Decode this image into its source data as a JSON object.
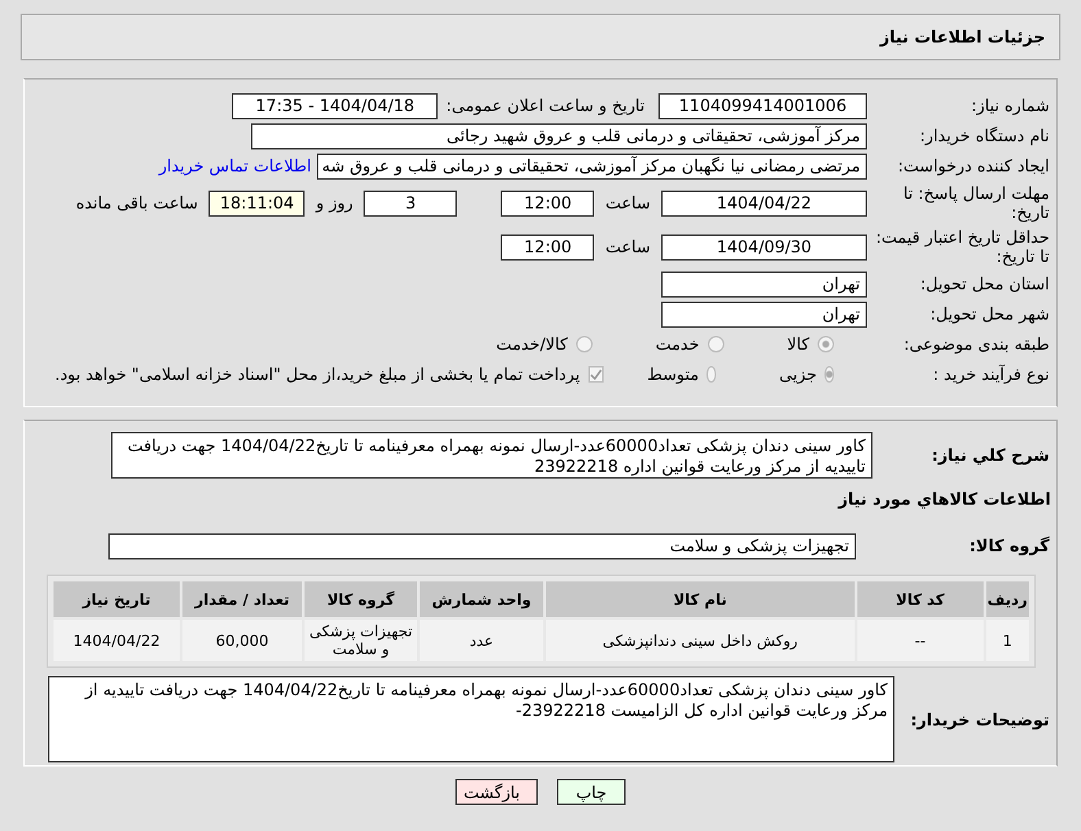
{
  "header": {
    "title": "جزئیات اطلاعات نیاز"
  },
  "need_number": {
    "label": "شماره نیاز:",
    "value": "1104099414001006"
  },
  "announce": {
    "label": "تاریخ و ساعت اعلان عمومی:",
    "value": "1404/04/18 - 17:35"
  },
  "buyer_org": {
    "label": "نام دستگاه خریدار:",
    "value": "مرکز آموزشی، تحقیقاتی و درمانی قلب و عروق شهید رجائی"
  },
  "creator": {
    "label": "ایجاد کننده درخواست:",
    "value": "مرتضی رمضانی نیا نگهبان مرکز آموزشی، تحقیقاتی و درمانی قلب و عروق شه",
    "link": "اطلاعات تماس خریدار"
  },
  "reply_deadline": {
    "label": "مهلت ارسال پاسخ: تا تاریخ:",
    "date": "1404/04/22",
    "time_label": "ساعت",
    "time": "12:00",
    "days": "3",
    "days_label": "روز و",
    "remaining": "18:11:04",
    "remaining_label": "ساعت باقی مانده"
  },
  "price_validity": {
    "label": "حداقل تاریخ اعتبار قیمت: تا تاریخ:",
    "date": "1404/09/30",
    "time_label": "ساعت",
    "time": "12:00"
  },
  "province": {
    "label": "استان محل تحویل:",
    "value": "تهران"
  },
  "city": {
    "label": "شهر محل تحویل:",
    "value": "تهران"
  },
  "category": {
    "label": "طبقه بندی موضوعی:",
    "options": [
      {
        "label": "کالا",
        "selected": true
      },
      {
        "label": "خدمت",
        "selected": false
      },
      {
        "label": "کالا/خدمت",
        "selected": false
      }
    ]
  },
  "process": {
    "label": "نوع فرآیند خرید :",
    "options": [
      {
        "label": "جزیی",
        "selected": true
      },
      {
        "label": "متوسط",
        "selected": false
      }
    ],
    "treasury": {
      "label": "پرداخت تمام یا بخشی از مبلغ خرید،از محل \"اسناد خزانه اسلامی\" خواهد بود.",
      "checked": true
    }
  },
  "description": {
    "label": "شرح کلي نیاز:",
    "value": "کاور سینی دندان پزشکی تعداد60000عدد-ارسال نمونه بهمراه معرفینامه تا تاریخ1404/04/22 جهت دریافت تاییدیه از مرکز ورعایت قوانین اداره 23922218"
  },
  "goods_heading": "اطلاعات کالاهاي مورد نیاز",
  "goods_group": {
    "label": "گروه کالا:",
    "value": "تجهیزات پزشکی و سلامت"
  },
  "table": {
    "columns": [
      "ردیف",
      "کد کالا",
      "نام کالا",
      "واحد شمارش",
      "گروه کالا",
      "تعداد / مقدار",
      "تاریخ نیاز"
    ],
    "rows": [
      [
        "1",
        "--",
        "روکش داخل سینی دندانپزشکی",
        "عدد",
        "تجهیزات پزشکی و سلامت",
        "60,000",
        "1404/04/22"
      ]
    ]
  },
  "buyer_notes": {
    "label": "توضیحات خریدار:",
    "value": "کاور سینی دندان پزشکی تعداد60000عدد-ارسال نمونه بهمراه معرفینامه تا تاریخ1404/04/22 جهت دریافت تاییدیه از مرکز ورعایت قوانین اداره کل الزامیست 23922218-"
  },
  "buttons": [
    {
      "label": "چاپ",
      "kind": "print"
    },
    {
      "label": "بازگشت",
      "kind": "back"
    }
  ]
}
